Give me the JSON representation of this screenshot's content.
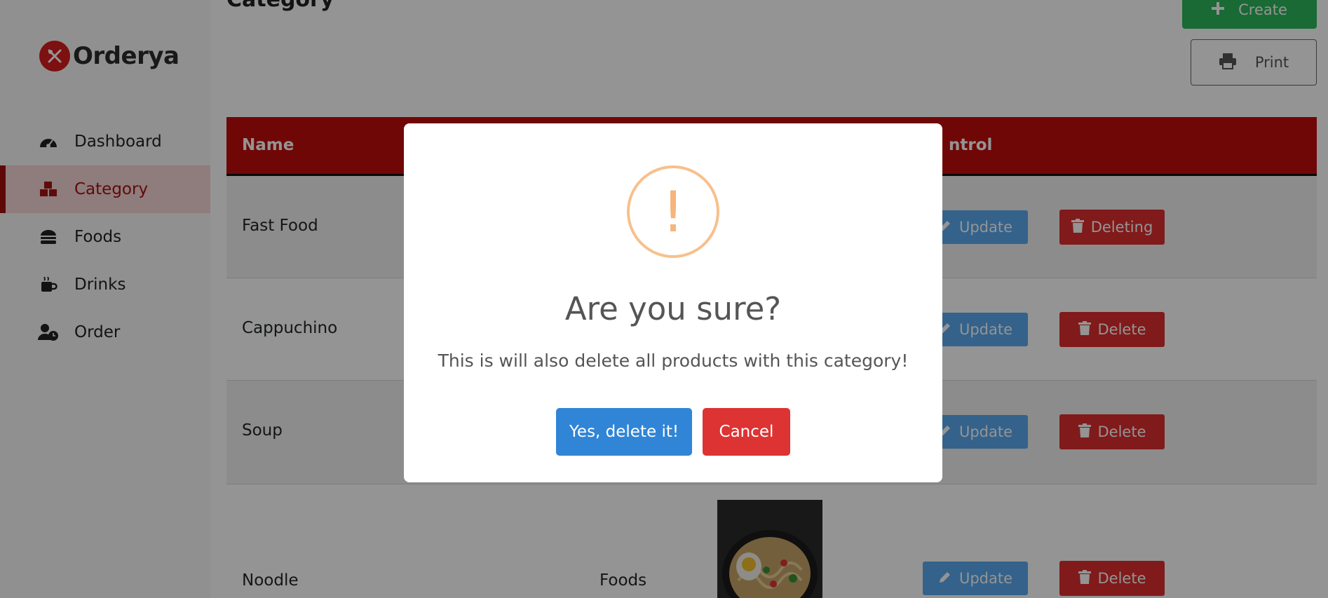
{
  "brand": {
    "name": "Orderya",
    "accent": "#d71c1c"
  },
  "sidebar": {
    "items": [
      {
        "label": "Dashboard",
        "icon": "gauge-icon"
      },
      {
        "label": "Category",
        "icon": "cubes-icon",
        "active": true
      },
      {
        "label": "Foods",
        "icon": "burger-icon"
      },
      {
        "label": "Drinks",
        "icon": "mug-icon"
      },
      {
        "label": "Order",
        "icon": "user-clock-icon"
      }
    ]
  },
  "header": {
    "title": "Category",
    "create_label": "Create",
    "print_label": "Print"
  },
  "table": {
    "columns": [
      "Name",
      "ntrol"
    ],
    "rows": [
      {
        "name": "Fast Food",
        "update_label": "Update",
        "delete_label": "Deleting"
      },
      {
        "name": "Cappuchino",
        "update_label": "Update",
        "delete_label": "Delete"
      },
      {
        "name": "Soup",
        "update_label": "Update",
        "delete_label": "Delete"
      },
      {
        "name": "Noodle",
        "type": "Foods",
        "update_label": "Update",
        "delete_label": "Delete"
      }
    ]
  },
  "modal": {
    "icon": "exclamation-icon",
    "title": "Are you sure?",
    "text": "This is will also delete all products with this category!",
    "confirm_label": "Yes, delete it!",
    "cancel_label": "Cancel",
    "confirm_color": "#3085d6",
    "cancel_color": "#dd3333"
  }
}
